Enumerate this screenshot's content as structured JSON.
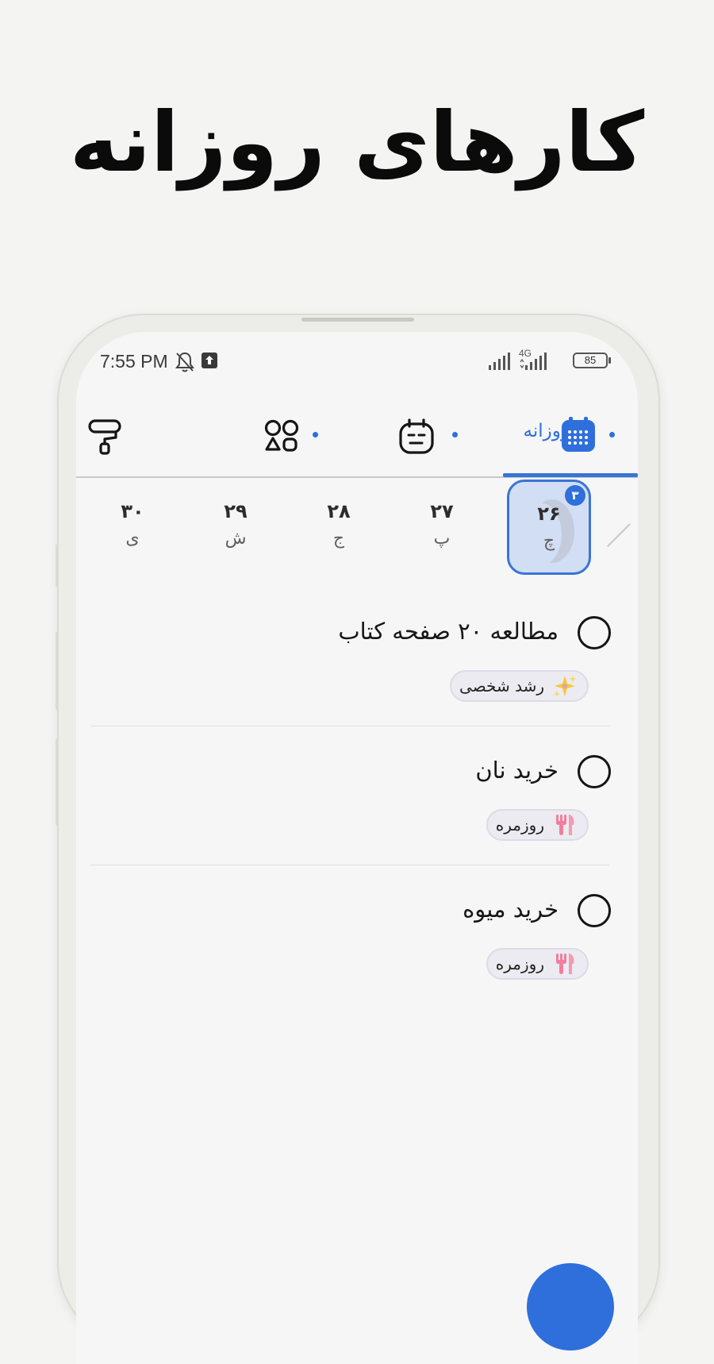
{
  "headline": "کارهای روزانه",
  "status_bar": {
    "time": "7:55 PM",
    "network": "4G",
    "battery": "85"
  },
  "tabs": [
    {
      "name": "paint-roller",
      "label": ""
    },
    {
      "name": "shapes",
      "label": ""
    },
    {
      "name": "weekly",
      "label": ""
    },
    {
      "name": "daily",
      "label": "روزانه",
      "selected": true
    }
  ],
  "days": [
    {
      "num": "۳۰",
      "name": "ی"
    },
    {
      "num": "۲۹",
      "name": "ش"
    },
    {
      "num": "۲۸",
      "name": "ج"
    },
    {
      "num": "۲۷",
      "name": "پ"
    },
    {
      "num": "۲۶",
      "name": "چ",
      "selected": true,
      "badge": "۳"
    }
  ],
  "tasks": [
    {
      "title": "مطالعه ۲۰ صفحه کتاب",
      "tag": "رشد شخصی",
      "tag_icon": "sparkles-icon"
    },
    {
      "title": "خرید نان",
      "tag": "روزمره",
      "tag_icon": "utensils-icon"
    },
    {
      "title": "خرید میوه",
      "tag": "روزمره",
      "tag_icon": "utensils-icon"
    }
  ],
  "colors": {
    "accent": "#2f6fdc",
    "selected_day_bg": "#d2def4",
    "background": "#f6f6f6"
  }
}
